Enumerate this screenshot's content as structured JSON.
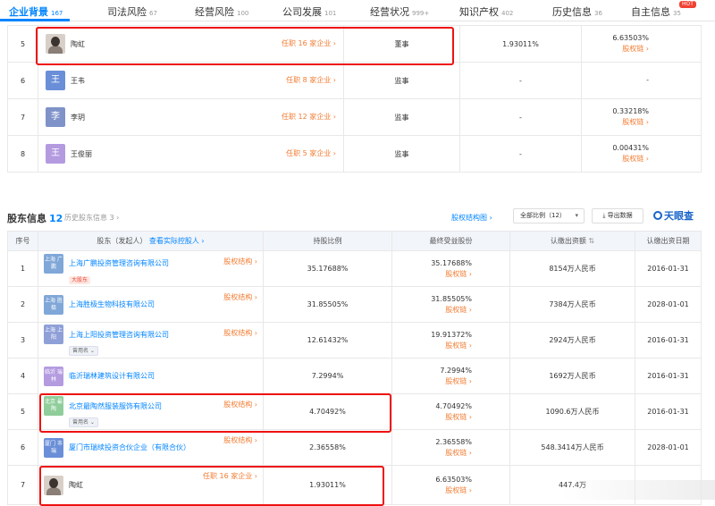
{
  "tabs": [
    {
      "label": "企业背景",
      "count": "167"
    },
    {
      "label": "司法风险",
      "count": "67"
    },
    {
      "label": "经营风险",
      "count": "100"
    },
    {
      "label": "公司发展",
      "count": "101"
    },
    {
      "label": "经营状况",
      "count": "999+"
    },
    {
      "label": "知识产权",
      "count": "402"
    },
    {
      "label": "历史信息",
      "count": "36"
    },
    {
      "label": "自主信息",
      "count": "35"
    }
  ],
  "hot_badge": "HOT",
  "staff_rows": [
    {
      "idx": "5",
      "name": "陶虹",
      "avatar": "",
      "avatar_color": "",
      "role_link": "任职 16 家企业 ›",
      "position": "董事",
      "ratio": "1.93011%",
      "final_ratio": "6.63503%",
      "chain": "股权链 ›"
    },
    {
      "idx": "6",
      "name": "王韦",
      "avatar": "王",
      "avatar_color": "#6a8fd8",
      "role_link": "任职 8 家企业 ›",
      "position": "监事",
      "ratio": "-",
      "final_ratio": "-",
      "chain": ""
    },
    {
      "idx": "7",
      "name": "李玥",
      "avatar": "李",
      "avatar_color": "#7f93c9",
      "role_link": "任职 12 家企业 ›",
      "position": "监事",
      "ratio": "-",
      "final_ratio": "0.33218%",
      "chain": "股权链 ›"
    },
    {
      "idx": "8",
      "name": "王俊丽",
      "avatar": "王",
      "avatar_color": "#b49be0",
      "role_link": "任职 5 家企业 ›",
      "position": "监事",
      "ratio": "-",
      "final_ratio": "0.00431%",
      "chain": "股权链 ›"
    }
  ],
  "shareholder_section": {
    "title": "股东信息",
    "count": "12",
    "history": "历史股东信息 3 ›",
    "structure": "股权结构图 ›",
    "select": "全部比例（12）",
    "export": "导出数据",
    "brand": "天眼查"
  },
  "shareholder_headers": {
    "idx": "序号",
    "holder": "股东（发起人）",
    "actual": "查看实际控股人 ›",
    "ratio": "持股比例",
    "final": "最终受益股份",
    "capital": "认缴出资额",
    "date": "认缴出资日期"
  },
  "shareholders": [
    {
      "idx": "1",
      "logo": "上海 广鹏",
      "logo_color": "#7fa7d8",
      "name": "上海广鹏投资管理咨询有限公司",
      "tag": "大股东",
      "tag_type": "big",
      "struct": "股权结构 ›",
      "ratio": "35.17688%",
      "final": "35.17688%",
      "chain": "股权链 ›",
      "capital": "8154万人民币",
      "date": "2016-01-31"
    },
    {
      "idx": "2",
      "logo": "上海 胜极",
      "logo_color": "#7fa7d8",
      "name": "上海胜极生物科技有限公司",
      "tag": "",
      "tag_type": "",
      "struct": "股权结构 ›",
      "ratio": "31.85505%",
      "final": "31.85505%",
      "chain": "股权链 ›",
      "capital": "7384万人民币",
      "date": "2028-01-01"
    },
    {
      "idx": "3",
      "logo": "上海 上阳",
      "logo_color": "#8fa0d8",
      "name": "上海上阳投资管理咨询有限公司",
      "tag": "曾用名 ⌄",
      "tag_type": "used",
      "struct": "股权结构 ›",
      "ratio": "12.61432%",
      "final": "19.91372%",
      "chain": "股权链 ›",
      "capital": "2924万人民币",
      "date": "2016-01-31"
    },
    {
      "idx": "4",
      "logo": "临沂 瑞林",
      "logo_color": "#b49be0",
      "name": "临沂瑞林建筑设计有限公司",
      "tag": "",
      "tag_type": "",
      "struct": "",
      "ratio": "7.2994%",
      "final": "7.2994%",
      "chain": "股权链 ›",
      "capital": "1692万人民币",
      "date": "2016-01-31"
    },
    {
      "idx": "5",
      "logo": "北京 最陶",
      "logo_color": "#8fce9a",
      "name": "北京最陶然服装服饰有限公司",
      "tag": "曾用名 ⌄",
      "tag_type": "used",
      "struct": "股权结构 ›",
      "ratio": "4.70492%",
      "final": "4.70492%",
      "chain": "股权链 ›",
      "capital": "1090.6万人民币",
      "date": "2016-01-31"
    },
    {
      "idx": "6",
      "logo": "厦门 市瑞",
      "logo_color": "#6a8fd8",
      "name": "厦门市瑞续投资合伙企业（有限合伙）",
      "tag": "",
      "tag_type": "",
      "struct": "股权结构 ›",
      "ratio": "2.36558%",
      "final": "2.36558%",
      "chain": "股权链 ›",
      "capital": "548.3414万人民币",
      "date": "2028-01-01"
    },
    {
      "idx": "7",
      "logo": "",
      "logo_color": "",
      "name": "陶虹",
      "tag": "",
      "tag_type": "",
      "struct": "任职 16 家企业 ›",
      "ratio": "1.93011%",
      "final": "6.63503%",
      "chain": "股权链 ›",
      "capital": "447.4万",
      "date": ""
    }
  ]
}
